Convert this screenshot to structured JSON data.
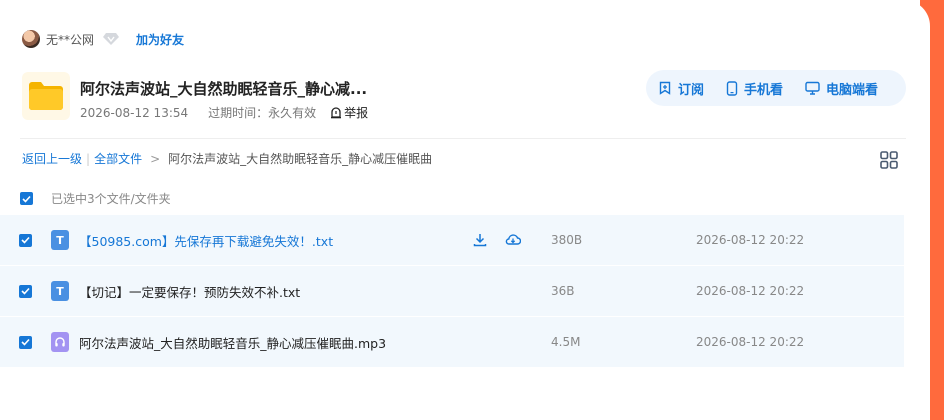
{
  "user": {
    "name": "无**公网",
    "add_friend": "加为好友"
  },
  "share": {
    "title": "阿尔法声波站_大自然助眠轻音乐_静心减...",
    "date": "2026-08-12 13:54",
    "expire_label": "过期时间：永久有效",
    "report": "举报"
  },
  "actions": {
    "subscribe": "订阅",
    "mobile": "手机看",
    "pc": "电脑端看"
  },
  "breadcrumb": {
    "back": "返回上一级",
    "all": "全部文件",
    "current": "阿尔法声波站_大自然助眠轻音乐_静心减压催眠曲"
  },
  "selection": {
    "text": "已选中3个文件/文件夹"
  },
  "files": [
    {
      "icon": "T",
      "name": "【50985.com】先保存再下载避免失效！.txt",
      "size": "380B",
      "date": "2026-08-12 20:22"
    },
    {
      "icon": "T",
      "name": "【切记】一定要保存！预防失效不补.txt",
      "size": "36B",
      "date": "2026-08-12 20:22"
    },
    {
      "icon": "music-note-icon",
      "name": "阿尔法声波站_大自然助眠轻音乐_静心减压催眠曲.mp3",
      "size": "4.5M",
      "date": "2026-08-12 20:22"
    }
  ],
  "colors": {
    "accent": "#1677d6",
    "brand_orange": "#ff6a3d",
    "row_bg": "#f2f8fd",
    "action_bg": "#eef5fd"
  }
}
